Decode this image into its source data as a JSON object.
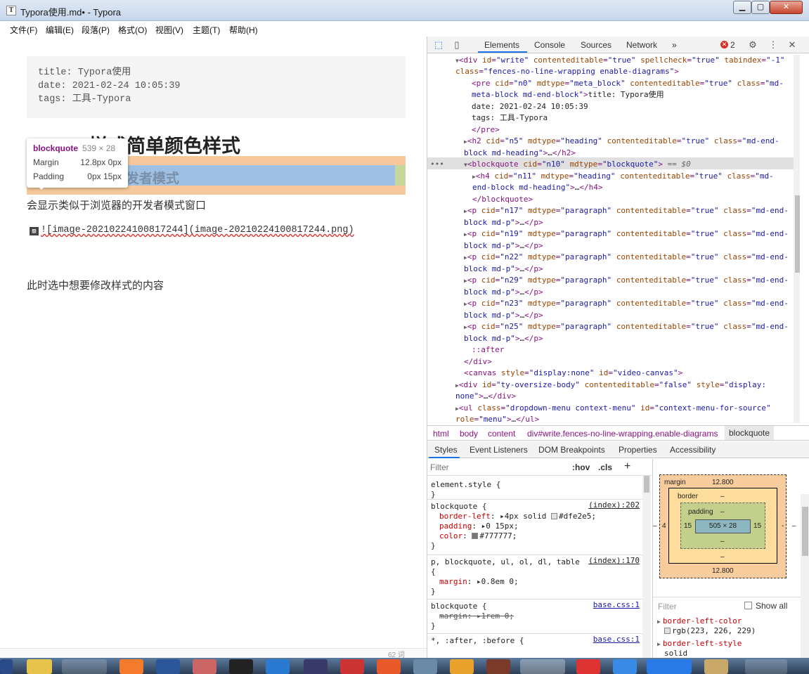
{
  "window": {
    "title": "Typora使用.md• - Typora",
    "app_icon_glyph": "T",
    "minimize_glyph": "▁",
    "maximize_glyph": "▢",
    "close_glyph": "✕"
  },
  "menu": [
    "文件(F)",
    "编辑(E)",
    "段落(P)",
    "格式(O)",
    "视图(V)",
    "主题(T)",
    "帮助(H)"
  ],
  "editor": {
    "meta_lines": [
      "title: Typora使用",
      "date: 2021-02-24 10:05:39",
      "tags: 工具-Typora"
    ],
    "heading": "Typora样式简单颜色样式",
    "blockquote_text": "进入 视图 > 开发者模式",
    "paragraph1": "会显示类似于浏览器的开发者模式窗口",
    "image_markdown": "![image-20210224100817244](image-20210224100817244.png)",
    "paragraph3": "此时选中想要修改样式的内容",
    "status_counter": "62 词"
  },
  "inspect_tooltip": {
    "tag": "blockquote",
    "size": "539 × 28",
    "margin_label": "Margin",
    "margin_value": "12.8px 0px",
    "padding_label": "Padding",
    "padding_value": "0px 15px"
  },
  "devtools": {
    "tabs": [
      "Elements",
      "Console",
      "Sources",
      "Network",
      "»"
    ],
    "error_count": "2",
    "icons": {
      "inspect": "inspect-icon",
      "device": "device-icon",
      "settings": "gear-icon",
      "more": "kebab-icon",
      "close": "close-icon"
    },
    "breadcrumb": [
      "html",
      "body",
      "content",
      "div#write.fences-no-line-wrapping.enable-diagrams",
      "blockquote"
    ],
    "lower_tabs": [
      "Styles",
      "Event Listeners",
      "DOM Breakpoints",
      "Properties",
      "Accessibility"
    ],
    "styles_filter_placeholder": "Filter",
    "hov": ":hov",
    "cls": ".cls",
    "plus": "+",
    "rules": [
      {
        "selector": "element.style {",
        "source": "",
        "decls": []
      },
      {
        "selector": "blockquote {",
        "source": "(index):202",
        "decls": [
          [
            "border-left",
            "4px solid",
            "#dfe2e5"
          ],
          [
            "padding",
            "0 15px",
            ""
          ],
          [
            "color",
            "",
            "#777777"
          ]
        ]
      },
      {
        "selector": "p, blockquote, ul, ol, dl, table {",
        "source": "(index):170",
        "decls": [
          [
            "margin",
            "0.8em 0",
            ""
          ]
        ]
      },
      {
        "selector": "blockquote {",
        "source": "base.css:1",
        "decls": [
          [
            "margin",
            "1rem 0",
            ""
          ]
        ]
      },
      {
        "selector": "*, :after, :before {",
        "source": "base.css:1",
        "decls": []
      }
    ],
    "box_model": {
      "margin_label": "margin",
      "margin_top": "12.800",
      "margin_bottom": "12.800",
      "margin_left": "4",
      "margin_right": "-",
      "border_label": "border",
      "border_value": "–",
      "padding_label": "padding",
      "padding_top": "–",
      "padding_bottom": "–",
      "padding_left": "15",
      "padding_right": "15",
      "content": "505 × 28",
      "content_bottom": "–",
      "outer_left": "–",
      "outer_right": "–"
    },
    "computed_filter_placeholder": "Filter",
    "show_all": "Show all",
    "computed": [
      {
        "name": "border-left-color",
        "value": "rgb(223, 226, 229)"
      },
      {
        "name": "border-left-style",
        "value": "solid"
      }
    ]
  },
  "colors": {
    "accent": "#1a73e8",
    "tag": "#881280",
    "attr_name": "#994500",
    "attr_value": "#1a1aa6",
    "margin_overlay": "#f6c89b",
    "padding_overlay": "#c3d89a",
    "content_overlay": "#9ec0e3"
  }
}
